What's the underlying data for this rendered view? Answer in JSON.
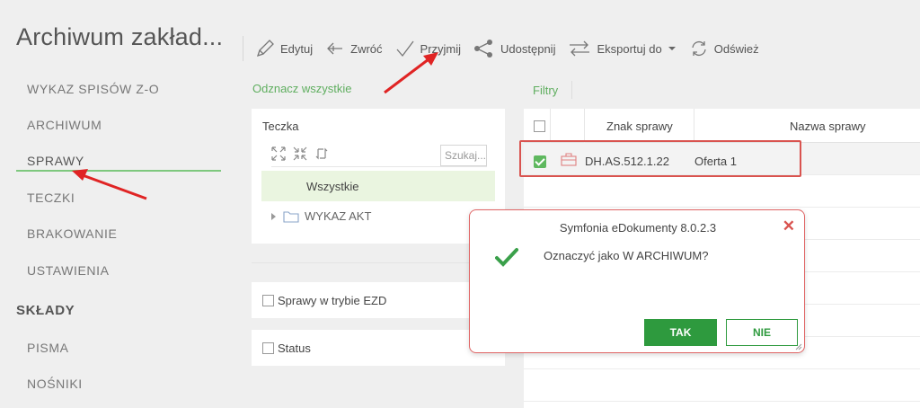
{
  "app": {
    "title": "Archiwum zakład..."
  },
  "sidebar": {
    "items": [
      {
        "label": "WYKAZ SPISÓW Z-O"
      },
      {
        "label": "ARCHIWUM"
      },
      {
        "label": "SPRAWY"
      },
      {
        "label": "TECZKI"
      },
      {
        "label": "BRAKOWANIE"
      },
      {
        "label": "USTAWIENIA"
      }
    ],
    "section": "SKŁADY",
    "section_items": [
      {
        "label": "PISMA"
      },
      {
        "label": "NOŚNIKI"
      }
    ]
  },
  "toolbar": {
    "edit": "Edytuj",
    "return": "Zwróć",
    "accept": "Przyjmij",
    "share": "Udostępnij",
    "export": "Eksportuj do",
    "refresh": "Odśwież"
  },
  "tree": {
    "select_all": "Odznacz wszystkie",
    "title": "Teczka",
    "search_placeholder": "Szukaj...",
    "all": "Wszystkie",
    "node": "WYKAZ AKT"
  },
  "filters": {
    "ezd": "Sprawy w trybie EZD",
    "status": "Status",
    "link": "Filtry"
  },
  "grid": {
    "columns": {
      "znak": "Znak sprawy",
      "nazwa": "Nazwa sprawy"
    },
    "rows": [
      {
        "znak": "DH.AS.512.1.22",
        "nazwa": "Oferta 1",
        "selected": true
      }
    ]
  },
  "dialog": {
    "title": "Symfonia eDokumenty 8.0.2.3",
    "message": "Oznaczyć jako W ARCHIWUM?",
    "yes": "TAK",
    "no": "NIE"
  },
  "colors": {
    "accent_green": "#2e9a3e",
    "link_green": "#5fae5f",
    "annotation_red": "#d9534f"
  }
}
